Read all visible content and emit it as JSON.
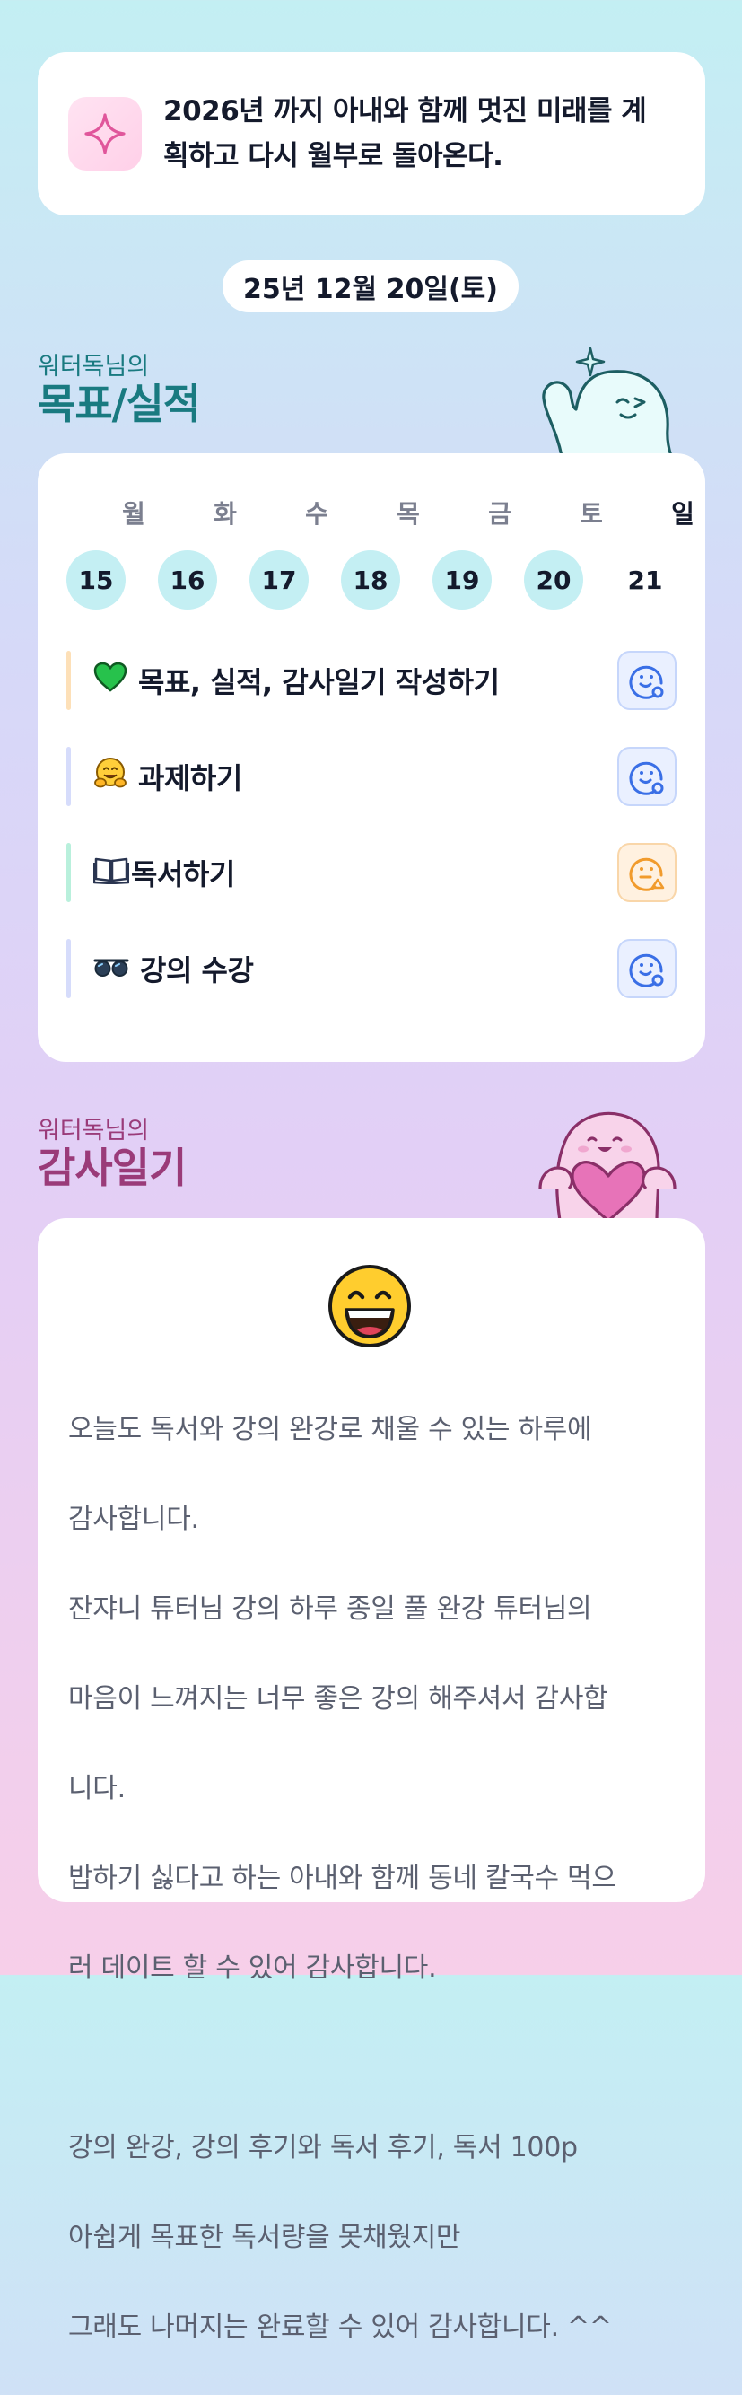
{
  "goal": {
    "icon": "sparkle-icon",
    "text_line1": "2026년 까지 아내와 함께 멋진 미래를 계",
    "text_line2": "획하고 다시 월부로 돌아온다."
  },
  "date": "25년 12월 20일(토)",
  "goals_section": {
    "subtitle": "워터독님의",
    "title": "목표/실적"
  },
  "week": {
    "days": [
      {
        "label": "월",
        "num": "15",
        "filled": true
      },
      {
        "label": "화",
        "num": "16",
        "filled": true
      },
      {
        "label": "수",
        "num": "17",
        "filled": true
      },
      {
        "label": "목",
        "num": "18",
        "filled": true
      },
      {
        "label": "금",
        "num": "19",
        "filled": true
      },
      {
        "label": "토",
        "num": "20",
        "filled": true
      },
      {
        "label": "일",
        "num": "21",
        "filled": false
      }
    ]
  },
  "tasks": [
    {
      "emoji": "💚",
      "label": "목표, 실적, 감사일기 작성하기",
      "bar_color": "#fde0b8",
      "status": "done-blue"
    },
    {
      "emoji": "🤗",
      "label": "과제하기",
      "bar_color": "#d6dcfb",
      "status": "done-blue"
    },
    {
      "emoji": "📖",
      "label": "독서하기",
      "bar_color": "#b9f0dc",
      "status": "partial-orange"
    },
    {
      "emoji": "🕶",
      "label": "강의 수강",
      "bar_color": "#d6dcfb",
      "status": "done-blue"
    }
  ],
  "gratitude_section": {
    "subtitle": "워터독님의",
    "title": "감사일기"
  },
  "diary": {
    "mood_icon": "grinning-face-icon",
    "lines": [
      "오늘도 독서와 강의 완강로 채울 수 있는 하루에",
      "감사합니다.",
      "잔쟈니 튜터님 강의 하루 종일 풀 완강 튜터님의",
      "마음이 느껴지는 너무 좋은 강의 해주셔서 감사합",
      "니다.",
      "밥하기 싫다고 하는 아내와 함께 동네 칼국수 먹으",
      "러 데이트 할 수 있어 감사합니다.",
      "",
      "강의 완강, 강의 후기와 독서 후기, 독서 100p",
      "아쉽게 목표한 독서량을 못채웠지만",
      "그래도 나머지는 완료할 수 있어 감사합니다. ^^"
    ]
  },
  "colors": {
    "teal_heading": "#197a80",
    "plum_heading": "#9a3b79",
    "day_fill": "#c4eff3",
    "status_blue": "#3a6fe6",
    "status_orange": "#f19b2c"
  }
}
